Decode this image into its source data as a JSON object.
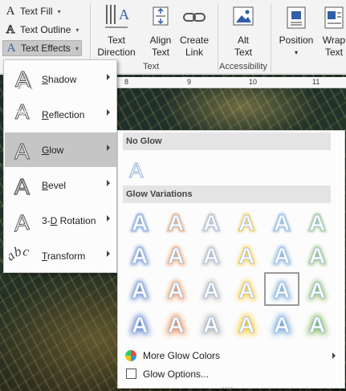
{
  "ribbon": {
    "text_fill": {
      "label": "Text Fill"
    },
    "text_outline": {
      "label": "Text Outline"
    },
    "text_effects": {
      "label": "Text Effects"
    },
    "text_direction": {
      "label1": "Text",
      "label2": "Direction"
    },
    "align_text": {
      "label1": "Align",
      "label2": "Text"
    },
    "create_link": {
      "label1": "Create",
      "label2": "Link"
    },
    "alt_text": {
      "label1": "Alt",
      "label2": "Text"
    },
    "position": {
      "label": "Position"
    },
    "wrap_text": {
      "label1": "Wrap",
      "label2": "Text"
    },
    "group_text": "Text",
    "group_accessibility": "Accessibility"
  },
  "ruler": {
    "marks": [
      "8",
      "9",
      "10",
      "11"
    ]
  },
  "text_effects_menu": {
    "items": [
      {
        "label": "Shadow",
        "accel": "S",
        "rest": "hadow",
        "icon": "shadow-a-icon"
      },
      {
        "label": "Reflection",
        "accel": "R",
        "rest": "eflection",
        "icon": "reflection-a-icon"
      },
      {
        "label": "Glow",
        "accel": "G",
        "rest": "low",
        "icon": "glow-a-icon",
        "active": true
      },
      {
        "label": "Bevel",
        "accel": "B",
        "rest": "evel",
        "icon": "bevel-a-icon"
      },
      {
        "label": "3-D Rotation",
        "pre": "3-",
        "accel": "D",
        "rest": " Rotation",
        "icon": "rotation-a-icon"
      },
      {
        "label": "Transform",
        "accel": "T",
        "rest": "ransform",
        "icon": "abc-transform-icon"
      }
    ]
  },
  "glow_menu": {
    "no_glow": "No Glow",
    "variations": "Glow Variations",
    "variation_colors": [
      "#4472c4",
      "#ed7d31",
      "#a5a5a5",
      "#ffc000",
      "#5b9bd5",
      "#70ad47"
    ],
    "selected": {
      "row": 2,
      "col": 4
    },
    "more_colors": "More Glow Colors",
    "options": "Glow Options...",
    "grip": "...."
  }
}
